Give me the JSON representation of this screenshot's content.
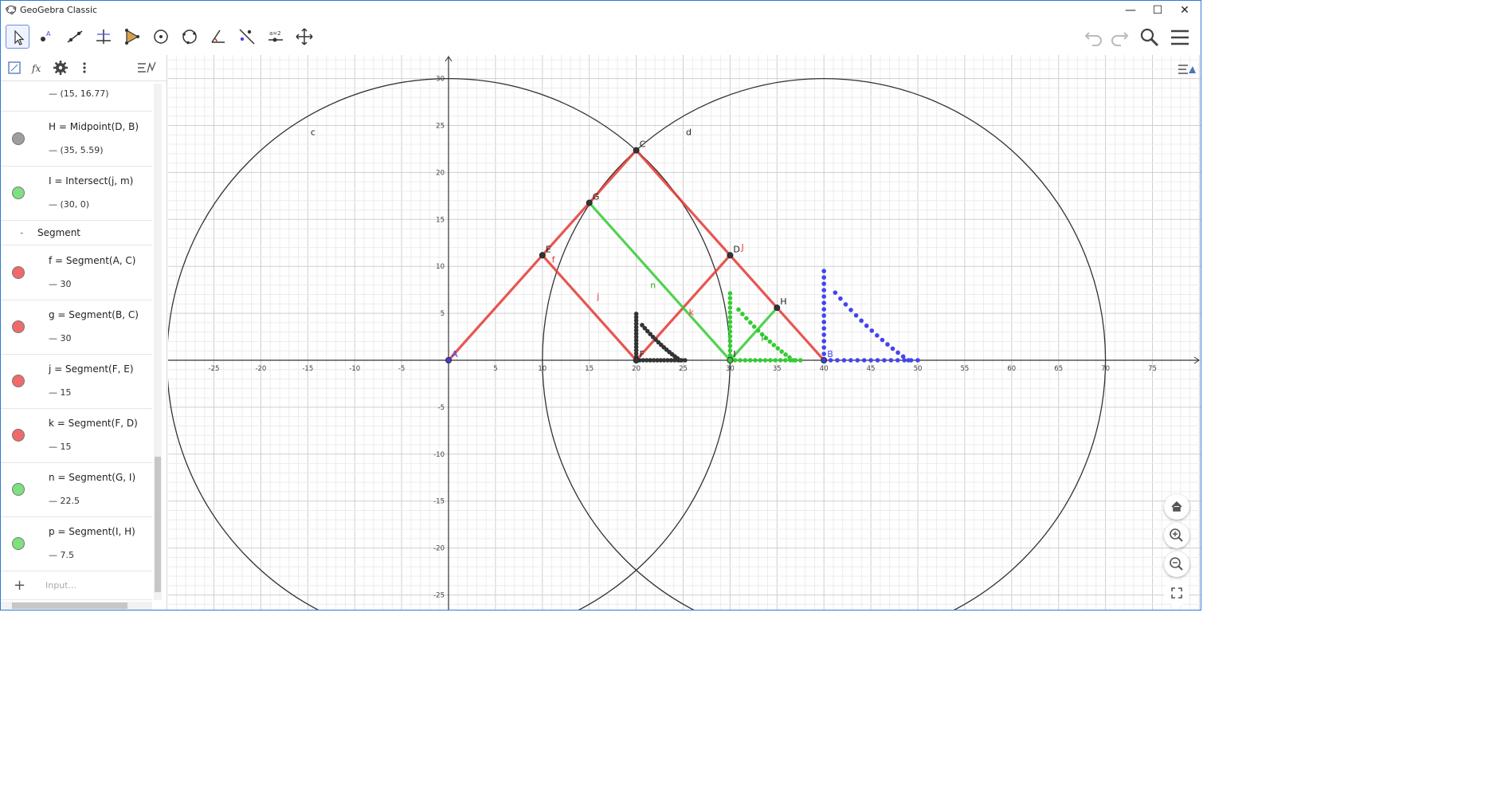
{
  "window": {
    "title": "GeoGebra Classic",
    "buttons": [
      "—",
      "☐",
      "✕"
    ]
  },
  "toolbar": {
    "tools": [
      "move-tool",
      "point-tool",
      "line-tool",
      "perpendicular-line-tool",
      "polygon-tool",
      "circle-tool",
      "circle-through-three-points-tool",
      "angle-tool",
      "reflect-tool",
      "slider-tool",
      "move-graphics-view-tool"
    ],
    "right": [
      "undo-icon",
      "redo-icon",
      "search-icon",
      "menu-icon"
    ]
  },
  "algebra": {
    "partial_value": "(15, 16.77)",
    "rows": [
      {
        "def": "H = Midpoint(D, B)",
        "value": "(35, 5.59)",
        "color": "#9e9e9e"
      },
      {
        "def": "I = Intersect(j, m)",
        "value": "(30, 0)",
        "color": "#7ee07e"
      },
      {
        "def": "f = Segment(A, C)",
        "value": "30",
        "color": "#f06a6a"
      },
      {
        "def": "g = Segment(B, C)",
        "value": "30",
        "color": "#f06a6a"
      },
      {
        "def": "j = Segment(F, E)",
        "value": "15",
        "color": "#f06a6a"
      },
      {
        "def": "k = Segment(F, D)",
        "value": "15",
        "color": "#f06a6a"
      },
      {
        "def": "n = Segment(G, I)",
        "value": "22.5",
        "color": "#7ee07e"
      },
      {
        "def": "p = Segment(I, H)",
        "value": "7.5",
        "color": "#7ee07e"
      }
    ],
    "category": "Segment",
    "input_placeholder": "Input..."
  },
  "graphics": {
    "x_ticks": [
      "-25",
      "-20",
      "-15",
      "-10",
      "-5",
      "5",
      "10",
      "15",
      "20",
      "25",
      "30",
      "35",
      "40",
      "45",
      "50",
      "55",
      "60",
      "65",
      "70",
      "75"
    ],
    "y_ticks": [
      "30",
      "25",
      "20",
      "15",
      "10",
      "5",
      "-5",
      "-10",
      "-15",
      "-20",
      "-25"
    ],
    "points": [
      {
        "name": "A",
        "label": "A",
        "x": 0,
        "y": 0,
        "color": "#3f3fcf"
      },
      {
        "name": "B",
        "label": "B",
        "x": 40,
        "y": 0,
        "color": "#3f3fcf"
      },
      {
        "name": "C",
        "label": "C",
        "x": 20,
        "y": 22.36,
        "color": "#333333"
      },
      {
        "name": "D",
        "label": "D",
        "x": 30,
        "y": 11.18,
        "color": "#333333"
      },
      {
        "name": "E",
        "label": "E",
        "x": 10,
        "y": 11.18,
        "color": "#333333"
      },
      {
        "name": "F",
        "label": "F",
        "x": 20,
        "y": 0,
        "color": "#333333"
      },
      {
        "name": "G",
        "label": "G",
        "x": 15,
        "y": 16.77,
        "color": "#333333"
      },
      {
        "name": "H",
        "label": "H",
        "x": 35,
        "y": 5.59,
        "color": "#333333"
      },
      {
        "name": "I",
        "label": "I",
        "x": 30,
        "y": 0,
        "color": "#3cbf3c"
      }
    ],
    "circles": [
      {
        "name": "c",
        "label": "c",
        "cx": 0,
        "cy": 0,
        "r": 30
      },
      {
        "name": "d",
        "label": "d",
        "cx": 40,
        "cy": 0,
        "r": 30
      }
    ],
    "object_labels": [
      {
        "text": "f",
        "x": 11,
        "y": 10.4,
        "color": "#e53935"
      },
      {
        "text": "j",
        "x": 15.8,
        "y": 6.5,
        "color": "#e53935"
      },
      {
        "text": "k",
        "x": 25.6,
        "y": 4.8,
        "color": "#e53935"
      },
      {
        "text": "n",
        "x": 21.5,
        "y": 7.7,
        "color": "#22b422"
      },
      {
        "text": "p",
        "x": 33.3,
        "y": 2.2,
        "color": "#22b422"
      },
      {
        "text": "J",
        "x": 31.2,
        "y": 11.7,
        "color": "#e53935"
      }
    ],
    "colors": {
      "red": "#e53935",
      "green": "#33cc33",
      "blue": "#4444ee",
      "black": "#333333",
      "grid_minor": "#ececec",
      "grid_major": "#cfcfcf"
    }
  },
  "navigation": [
    "home-icon",
    "zoom-in-icon",
    "zoom-out-icon",
    "fullscreen-icon"
  ]
}
